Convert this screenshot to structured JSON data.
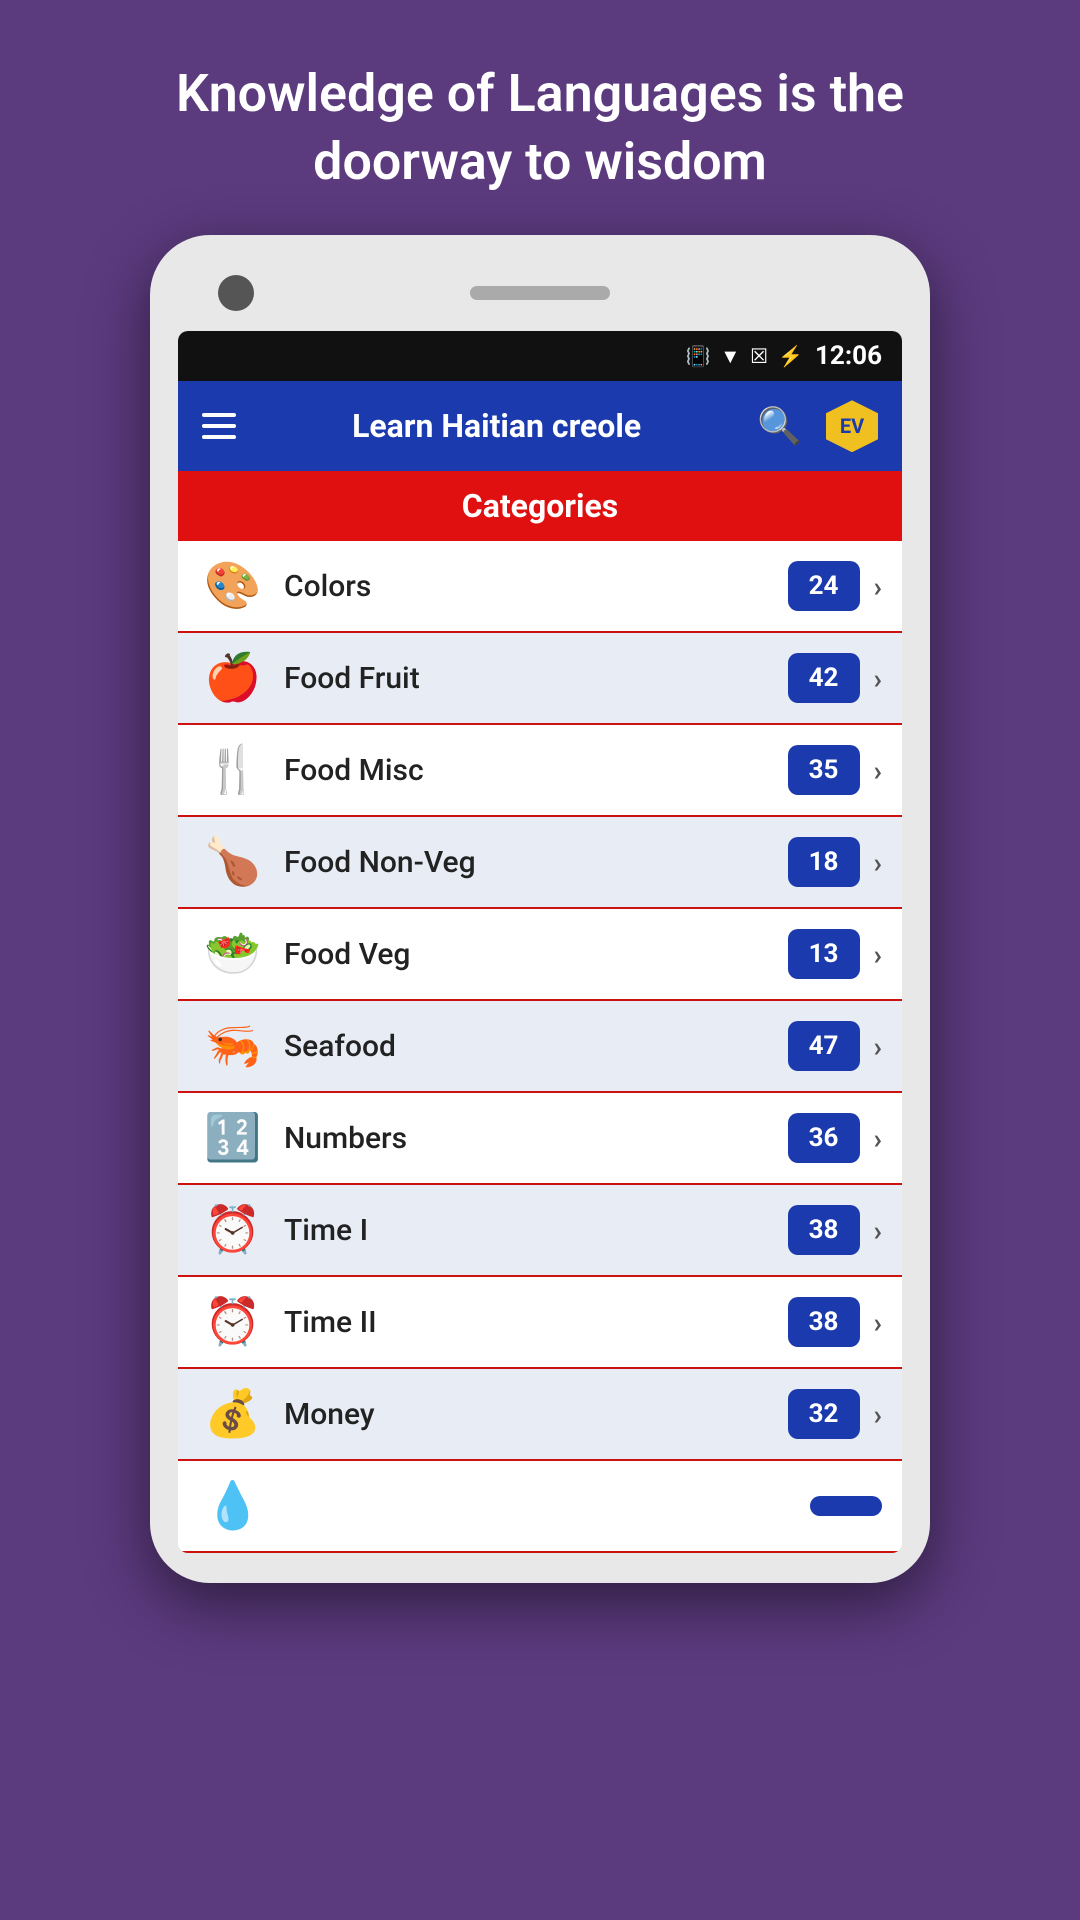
{
  "header": {
    "tagline": "Knowledge of Languages is the doorway to wisdom"
  },
  "statusBar": {
    "time": "12:06",
    "icons": [
      "vibrate",
      "wifi",
      "no-signal",
      "battery"
    ]
  },
  "appBar": {
    "title": "Learn Haitian creole",
    "logoText": "EV"
  },
  "categoriesBar": {
    "label": "Categories"
  },
  "categories": [
    {
      "name": "Colors",
      "count": "24",
      "emoji": "🎨"
    },
    {
      "name": "Food Fruit",
      "count": "42",
      "emoji": "🍎"
    },
    {
      "name": "Food Misc",
      "count": "35",
      "emoji": "🍴"
    },
    {
      "name": "Food Non-Veg",
      "count": "18",
      "emoji": "🍗"
    },
    {
      "name": "Food Veg",
      "count": "13",
      "emoji": "🥗"
    },
    {
      "name": "Seafood",
      "count": "47",
      "emoji": "🦐"
    },
    {
      "name": "Numbers",
      "count": "36",
      "emoji": "🔢"
    },
    {
      "name": "Time I",
      "count": "38",
      "emoji": "⏰"
    },
    {
      "name": "Time II",
      "count": "38",
      "emoji": "⏰"
    },
    {
      "name": "Money",
      "count": "32",
      "emoji": "💰"
    },
    {
      "name": "...",
      "count": "",
      "emoji": "💧"
    }
  ]
}
